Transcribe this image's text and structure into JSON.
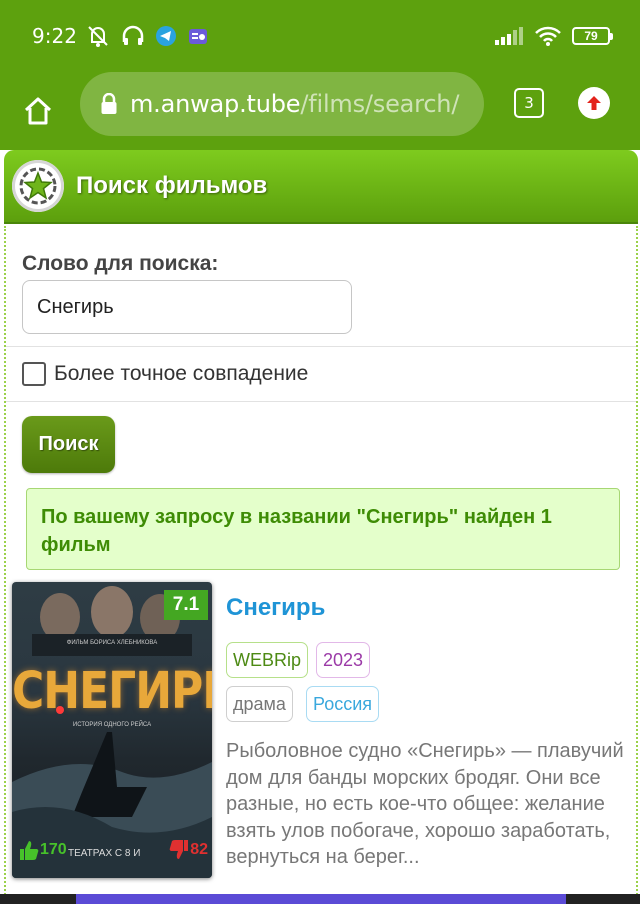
{
  "status_bar": {
    "time": "9:22",
    "battery": "79",
    "icons_left": [
      "mute-icon",
      "headphones-icon",
      "telegram-icon",
      "radio-icon"
    ],
    "icons_right": [
      "signal-icon",
      "wifi-icon",
      "battery-icon"
    ]
  },
  "browser": {
    "url_domain": "m.anwap.tube",
    "url_path": "/films/search/",
    "tabs_count": "3"
  },
  "header": {
    "title": "Поиск фильмов"
  },
  "search": {
    "label": "Слово для поиска:",
    "value": "Снегирь",
    "checkbox_label": "Более точное совпадение",
    "checkbox_checked": false,
    "button_label": "Поиск"
  },
  "result_notice": "По вашему запросу в названии \"Снегирь\" найден 1 фильм",
  "film": {
    "title": "Снегирь",
    "rating": "7.1",
    "poster_title": "СНЕГИРЬ",
    "poster_credit": "ФИЛЬМ БОРИСА ХЛЕБНИКОВА",
    "poster_subtitle": "ИСТОРИЯ ОДНОГО РЕЙСА",
    "poster_tagline": "ТЕАТРАХ С 8 И",
    "likes": "170",
    "dislikes": "82",
    "quality": "WEBRip",
    "year": "2023",
    "genre": "драма",
    "country": "Россия",
    "description": "Рыболовное судно «Снегирь» — плавучий дом для банды морских бродяг. Они все разные, но есть кое-что общее: желание взять улов побогаче, хорошо заработать, вернуться на берег..."
  },
  "colors": {
    "brand_green": "#5da10e",
    "link_blue": "#1f94d6",
    "notice_bg": "#e4ffcb",
    "notice_text": "#3e8c05"
  }
}
